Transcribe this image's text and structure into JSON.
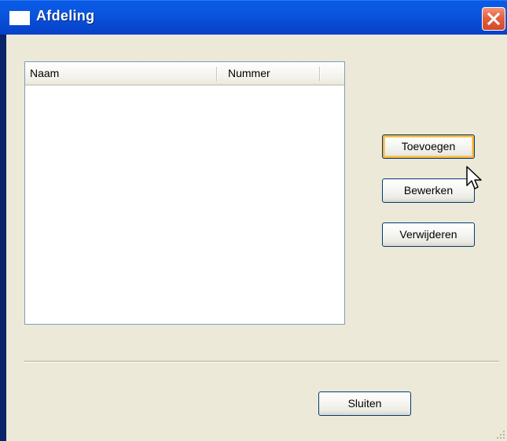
{
  "window": {
    "title": "Afdeling",
    "icon": "window-icon",
    "close_icon": "close-icon"
  },
  "list": {
    "columns": [
      "Naam",
      "Nummer"
    ],
    "rows": []
  },
  "actions": {
    "add_label": "Toevoegen",
    "edit_label": "Bewerken",
    "delete_label": "Verwijderen"
  },
  "footer": {
    "close_label": "Sluiten"
  },
  "cursor": {
    "icon": "pointer-cursor-icon",
    "hovering": "Toevoegen"
  },
  "colors": {
    "titlebar": "#0a58e0",
    "client_background": "#ece9d8",
    "close_button": "#e5603f",
    "button_border": "#003c74",
    "hover_highlight": "#f8b33a",
    "list_border": "#7f9db9"
  }
}
